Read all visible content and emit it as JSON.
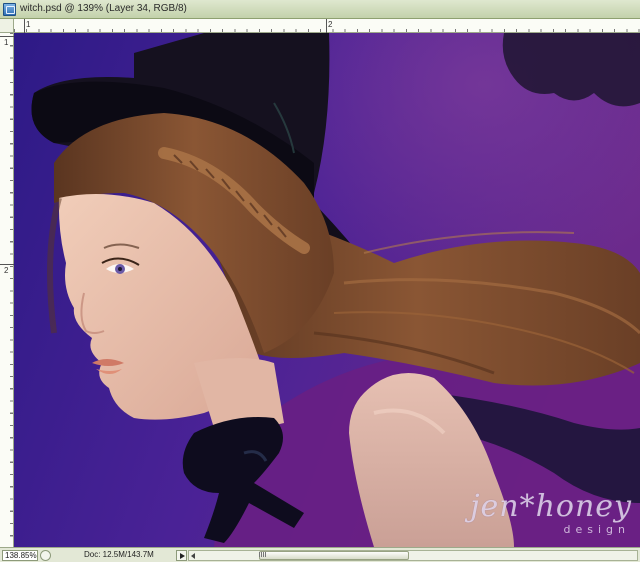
{
  "window": {
    "title": "witch.psd @ 139% (Layer 34, RGB/8)",
    "icon": "photoshop-document-icon"
  },
  "rulers": {
    "top_labels": [
      "1",
      "2"
    ],
    "left_labels": [
      "1",
      "2"
    ]
  },
  "canvas": {
    "watermark_main": "jen*honey",
    "watermark_sub": "design",
    "colors": {
      "background": "#3d1f8c",
      "background_right": "#6a2a8e",
      "skin": "#e9c2ae",
      "hair": "#7a4a2c",
      "hat": "#14101e"
    }
  },
  "statusbar": {
    "zoom_value": "138.85%",
    "doc_info": "Doc: 12.5M/143.7M"
  }
}
